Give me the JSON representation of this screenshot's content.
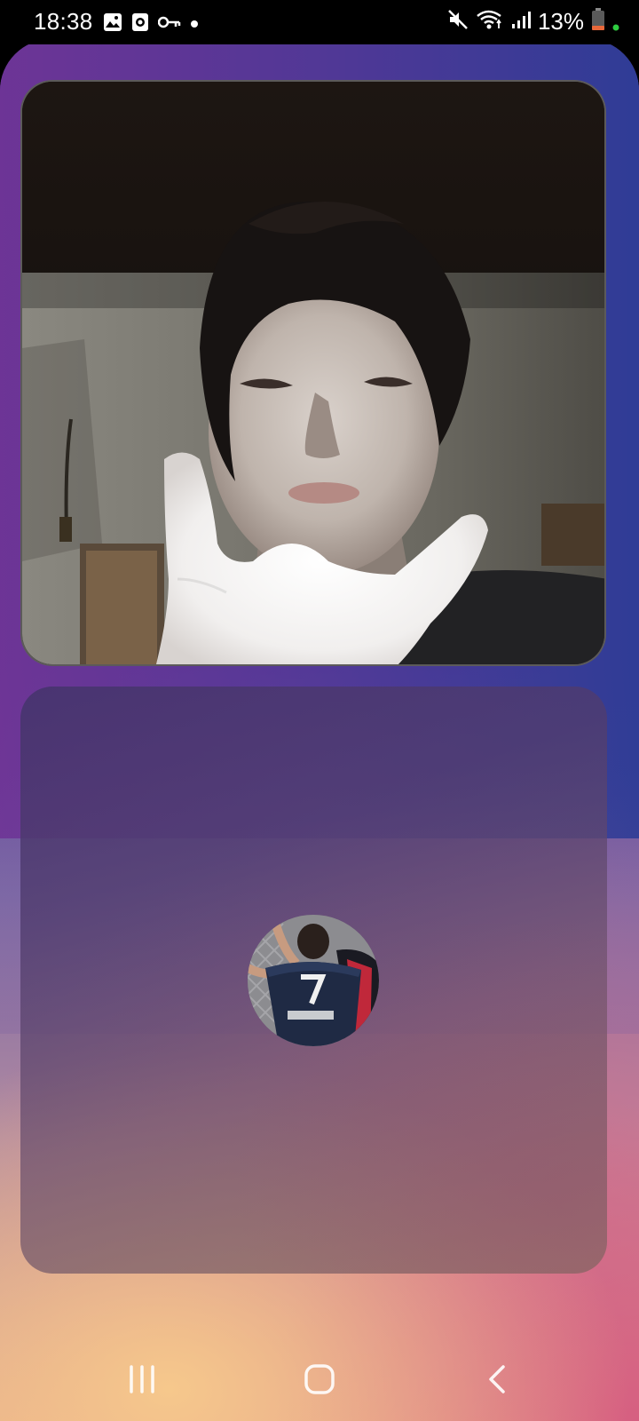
{
  "status_bar": {
    "time": "18:38",
    "battery_percent": "13%",
    "left_icons": [
      "gallery-icon",
      "screen-record-icon",
      "vpn-key-icon",
      "dot-icon"
    ],
    "right_icons": [
      "mute-icon",
      "wifi-icon",
      "signal-icon",
      "battery-icon"
    ],
    "battery_level": 0.13,
    "battery_color": "#e8683a",
    "privacy_dot_color": "#2ecc40"
  },
  "call": {
    "remote_video": "remote-participant-video",
    "local_avatar": "local-user-avatar"
  },
  "nav_bar": {
    "buttons": [
      "recent-apps-icon",
      "home-icon",
      "back-icon"
    ]
  },
  "colors": {
    "gradient_top_left": "#6e3496",
    "gradient_top_right": "#2d3c96",
    "gradient_bottom_left": "#f6c88c",
    "gradient_bottom_right": "#d65c80"
  }
}
